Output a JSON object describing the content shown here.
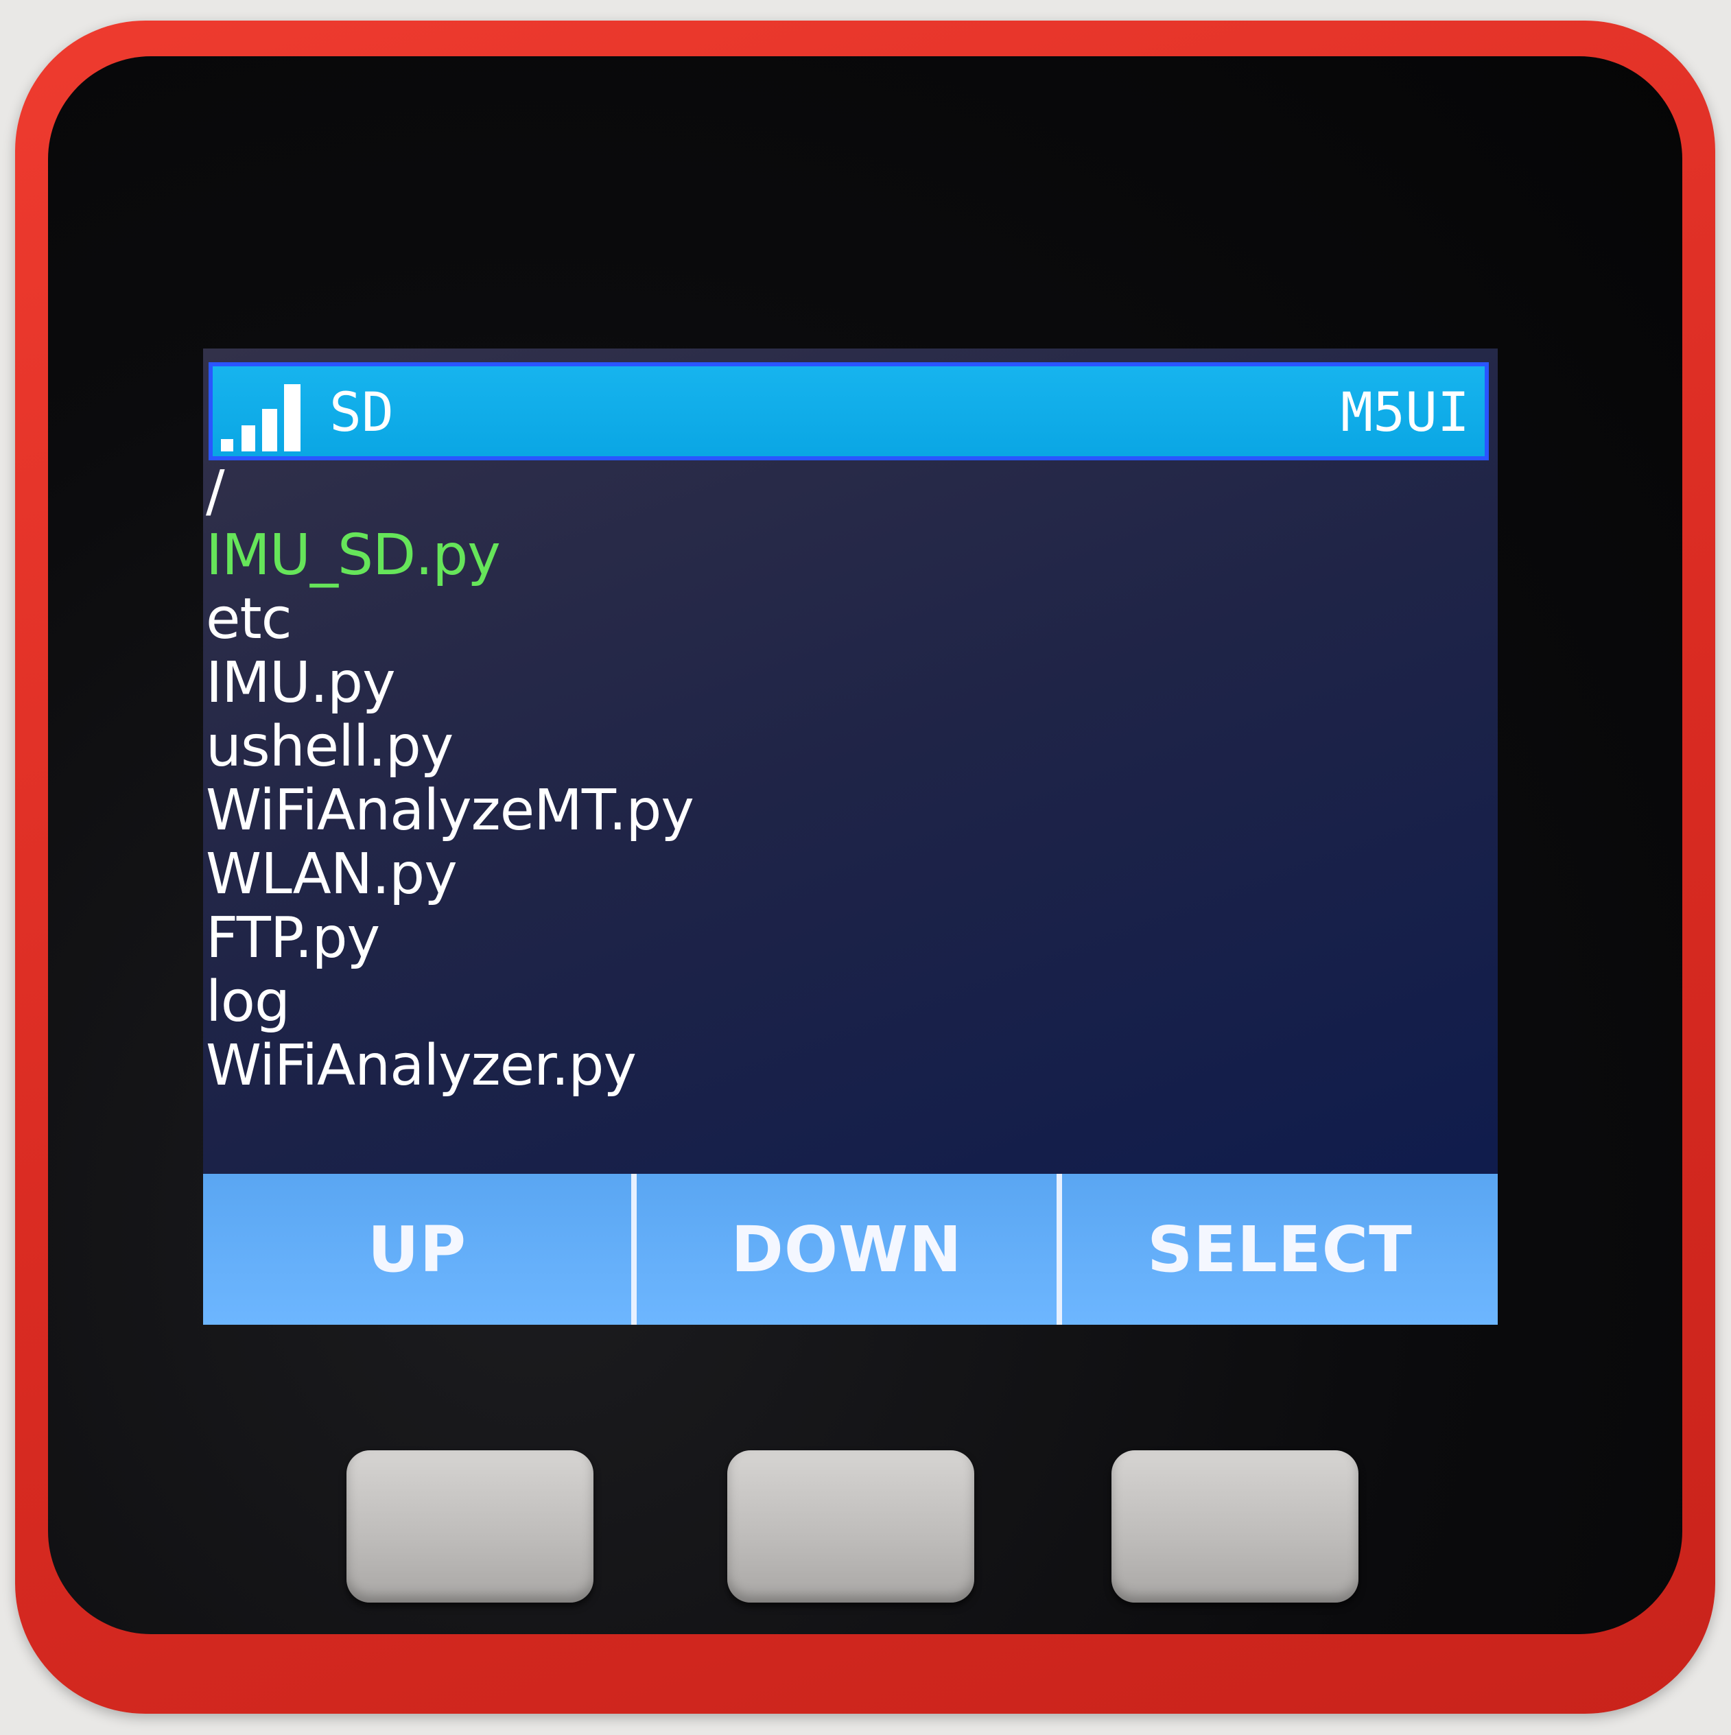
{
  "titlebar": {
    "left_label": "SD",
    "right_label": "M5UI",
    "signal_icon": "signal-strength-icon",
    "color": "#0aa6e4",
    "border_color": "#2a56ff"
  },
  "file_browser": {
    "current_path": "/",
    "selected_index": 0,
    "selected_color": "#66e55a",
    "items": [
      "IMU_SD.py",
      "etc",
      "IMU.py",
      "ushell.py",
      "WiFiAnalyzeMT.py",
      "WLAN.py",
      "FTP.py",
      "log",
      "WiFiAnalyzer.py"
    ]
  },
  "softkeys": {
    "a_label": "UP",
    "b_label": "DOWN",
    "c_label": "SELECT",
    "bar_color": "#6db6ff"
  },
  "device": {
    "body_color": "#e3312a"
  }
}
